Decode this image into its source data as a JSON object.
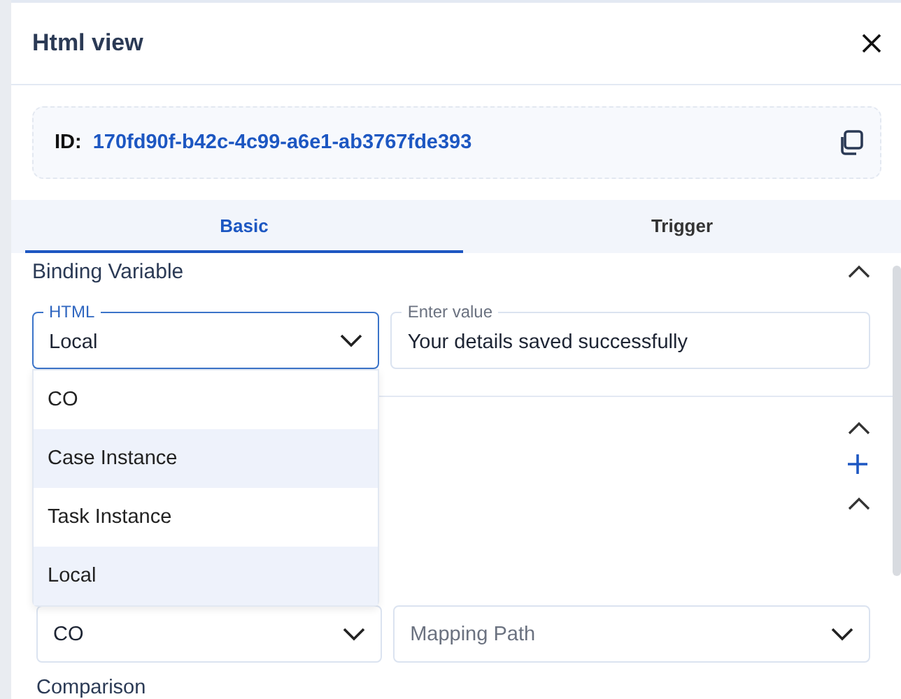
{
  "dialog": {
    "title": "Html view"
  },
  "id_card": {
    "label": "ID:",
    "value": "170fd90f-b42c-4c99-a6e1-ab3767fde393"
  },
  "tabs": [
    {
      "label": "Basic",
      "selected": true
    },
    {
      "label": "Trigger",
      "selected": false
    }
  ],
  "sections": [
    {
      "title": "Binding Variable",
      "expanded": true,
      "fields": [
        {
          "kind": "select",
          "label": "HTML",
          "value": "Local",
          "focused": true,
          "open": true
        },
        {
          "kind": "text",
          "label": "Enter value",
          "value": "Your details saved successfully",
          "focused": false
        }
      ]
    },
    {
      "expanded": true,
      "add_button": true
    },
    {
      "expanded": true,
      "fields": [
        {
          "kind": "select",
          "value": "CO",
          "focused": false
        },
        {
          "kind": "select",
          "placeholder": "Mapping Path",
          "focused": false
        }
      ]
    }
  ],
  "comparison_label": "Comparison",
  "dropdown": {
    "options": [
      {
        "label": "CO",
        "highlighted": false
      },
      {
        "label": "Case Instance",
        "highlighted": true
      },
      {
        "label": "Task Instance",
        "highlighted": false
      },
      {
        "label": "Local",
        "highlighted": true
      }
    ]
  }
}
